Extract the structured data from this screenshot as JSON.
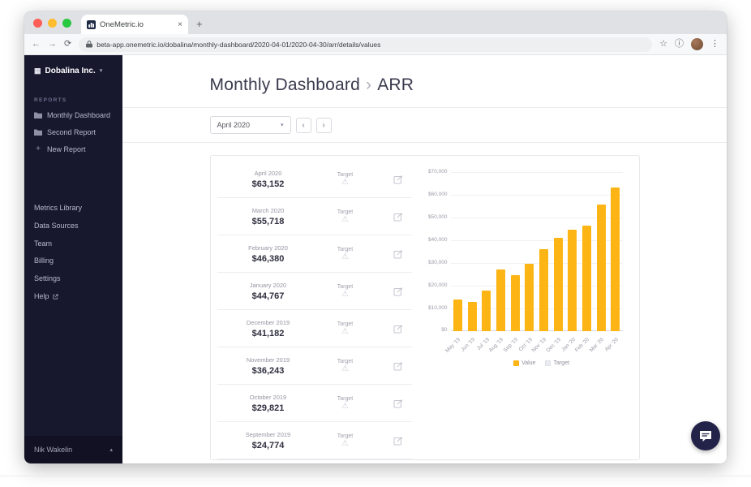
{
  "browser": {
    "tab_title": "OneMetric.io",
    "url": "beta-app.onemetric.io/dobalina/monthly-dashboard/2020-04-01/2020-04-30/arr/details/values"
  },
  "icons": {
    "back": "←",
    "forward": "→",
    "refresh": "⟳",
    "star": "☆",
    "info": "ⓘ",
    "menu": "⋮",
    "close_tab": "×",
    "plus": "+",
    "chevron_down": "▾",
    "chevron_up": "▴",
    "prev": "‹",
    "next": "›",
    "warning": "⚠",
    "org": "▦"
  },
  "sidebar": {
    "org_name": "Dobalina Inc.",
    "reports_heading": "REPORTS",
    "reports": [
      "Monthly Dashboard",
      "Second Report"
    ],
    "new_report_label": "New Report",
    "nav_items": [
      {
        "label": "Metrics Library"
      },
      {
        "label": "Data Sources"
      },
      {
        "label": "Team"
      },
      {
        "label": "Billing"
      },
      {
        "label": "Settings"
      },
      {
        "label": "Help",
        "external": true
      }
    ],
    "user_name": "Nik Wakelin"
  },
  "header": {
    "title": "Monthly Dashboard",
    "separator": "›",
    "metric": "ARR"
  },
  "toolbar": {
    "period": "April 2020"
  },
  "table": {
    "target_label": "Target",
    "rows": [
      {
        "month": "April 2020",
        "value": "$63,152"
      },
      {
        "month": "March 2020",
        "value": "$55,718"
      },
      {
        "month": "February 2020",
        "value": "$46,380"
      },
      {
        "month": "January 2020",
        "value": "$44,767"
      },
      {
        "month": "December 2019",
        "value": "$41,182"
      },
      {
        "month": "November 2019",
        "value": "$36,243"
      },
      {
        "month": "October 2019",
        "value": "$29,821"
      },
      {
        "month": "September 2019",
        "value": "$24,774"
      }
    ]
  },
  "chart_data": {
    "type": "bar",
    "title": "",
    "categories": [
      "May '19",
      "Jun '19",
      "Jul '19",
      "Aug '19",
      "Sep '19",
      "Oct '19",
      "Nov '19",
      "Dec '19",
      "Jan '20",
      "Feb '20",
      "Mar '20",
      "Apr '20"
    ],
    "series": [
      {
        "name": "Value",
        "color": "#fcb514",
        "values": [
          14000,
          13000,
          18000,
          27000,
          24774,
          29821,
          36243,
          41182,
          44767,
          46380,
          55718,
          63152
        ]
      },
      {
        "name": "Target",
        "color": "#ebebf2",
        "values": []
      }
    ],
    "ylim": [
      0,
      70000
    ],
    "ytick_step": 10000,
    "yticks": [
      "$0",
      "$10,000",
      "$20,000",
      "$30,000",
      "$40,000",
      "$50,000",
      "$60,000",
      "$70,000"
    ],
    "grid": true,
    "legend_position": "bottom"
  }
}
